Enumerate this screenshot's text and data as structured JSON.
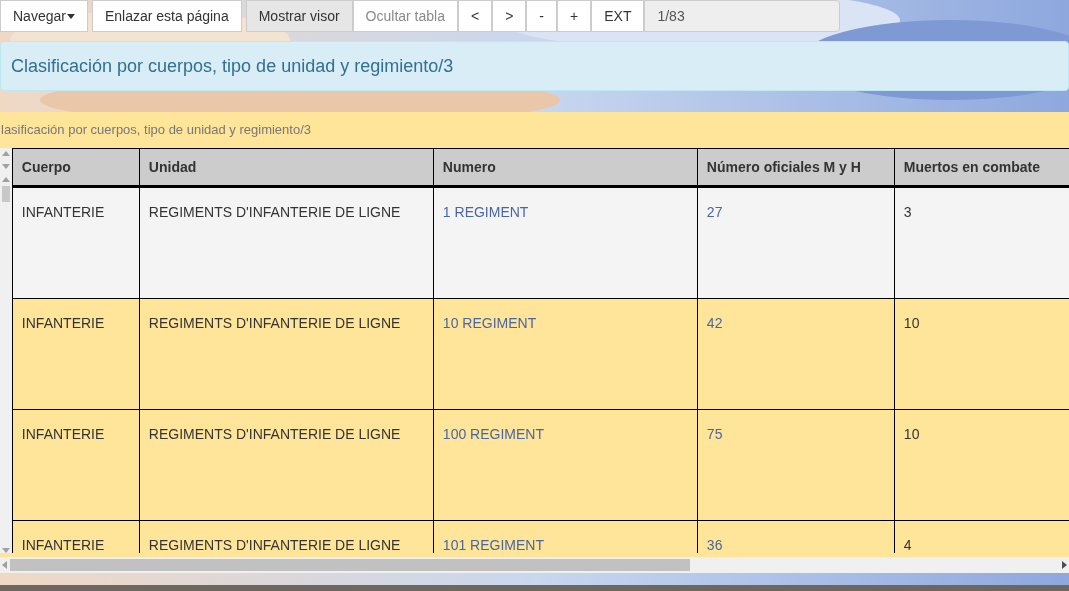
{
  "toolbar": {
    "buttons": [
      {
        "label": "Navegar",
        "kind": "dropdown",
        "selected": false,
        "disabled": false
      },
      {
        "label": "Enlazar esta página",
        "kind": "button",
        "selected": false,
        "disabled": false
      },
      {
        "label": "Mostrar visor",
        "kind": "button",
        "selected": true,
        "disabled": false
      },
      {
        "label": "Ocultar tabla",
        "kind": "button",
        "selected": false,
        "disabled": true
      },
      {
        "label": "<",
        "kind": "button",
        "selected": false,
        "disabled": false
      },
      {
        "label": ">",
        "kind": "button",
        "selected": false,
        "disabled": false
      },
      {
        "label": "-",
        "kind": "button",
        "selected": false,
        "disabled": false
      },
      {
        "label": "+",
        "kind": "button",
        "selected": false,
        "disabled": false
      },
      {
        "label": "EXT",
        "kind": "button",
        "selected": false,
        "disabled": false
      }
    ],
    "page_field": {
      "value": "1/83"
    }
  },
  "banner": {
    "title": "Clasificación por cuerpos, tipo de unidad y regimiento/3"
  },
  "table": {
    "caption": "lasificación por cuerpos, tipo de unidad y regimiento/3",
    "columns": [
      "Cuerpo",
      "Unidad",
      "Numero",
      "Número oficiales M y H",
      "Muertos en combate"
    ],
    "rows": [
      {
        "selected": true,
        "cells": [
          "INFANTERIE",
          "REGIMENTS D'INFANTERIE DE LIGNE",
          "1 REGIMENT",
          "27",
          "3"
        ]
      },
      {
        "selected": false,
        "cells": [
          "INFANTERIE",
          "REGIMENTS D'INFANTERIE DE LIGNE",
          "10 REGIMENT",
          "42",
          "10"
        ]
      },
      {
        "selected": false,
        "cells": [
          "INFANTERIE",
          "REGIMENTS D'INFANTERIE DE LIGNE",
          "100 REGIMENT",
          "75",
          "10"
        ]
      },
      {
        "selected": false,
        "cells": [
          "INFANTERIE",
          "REGIMENTS D'INFANTERIE DE LIGNE",
          "101 REGIMENT",
          "36",
          "4"
        ]
      }
    ]
  }
}
